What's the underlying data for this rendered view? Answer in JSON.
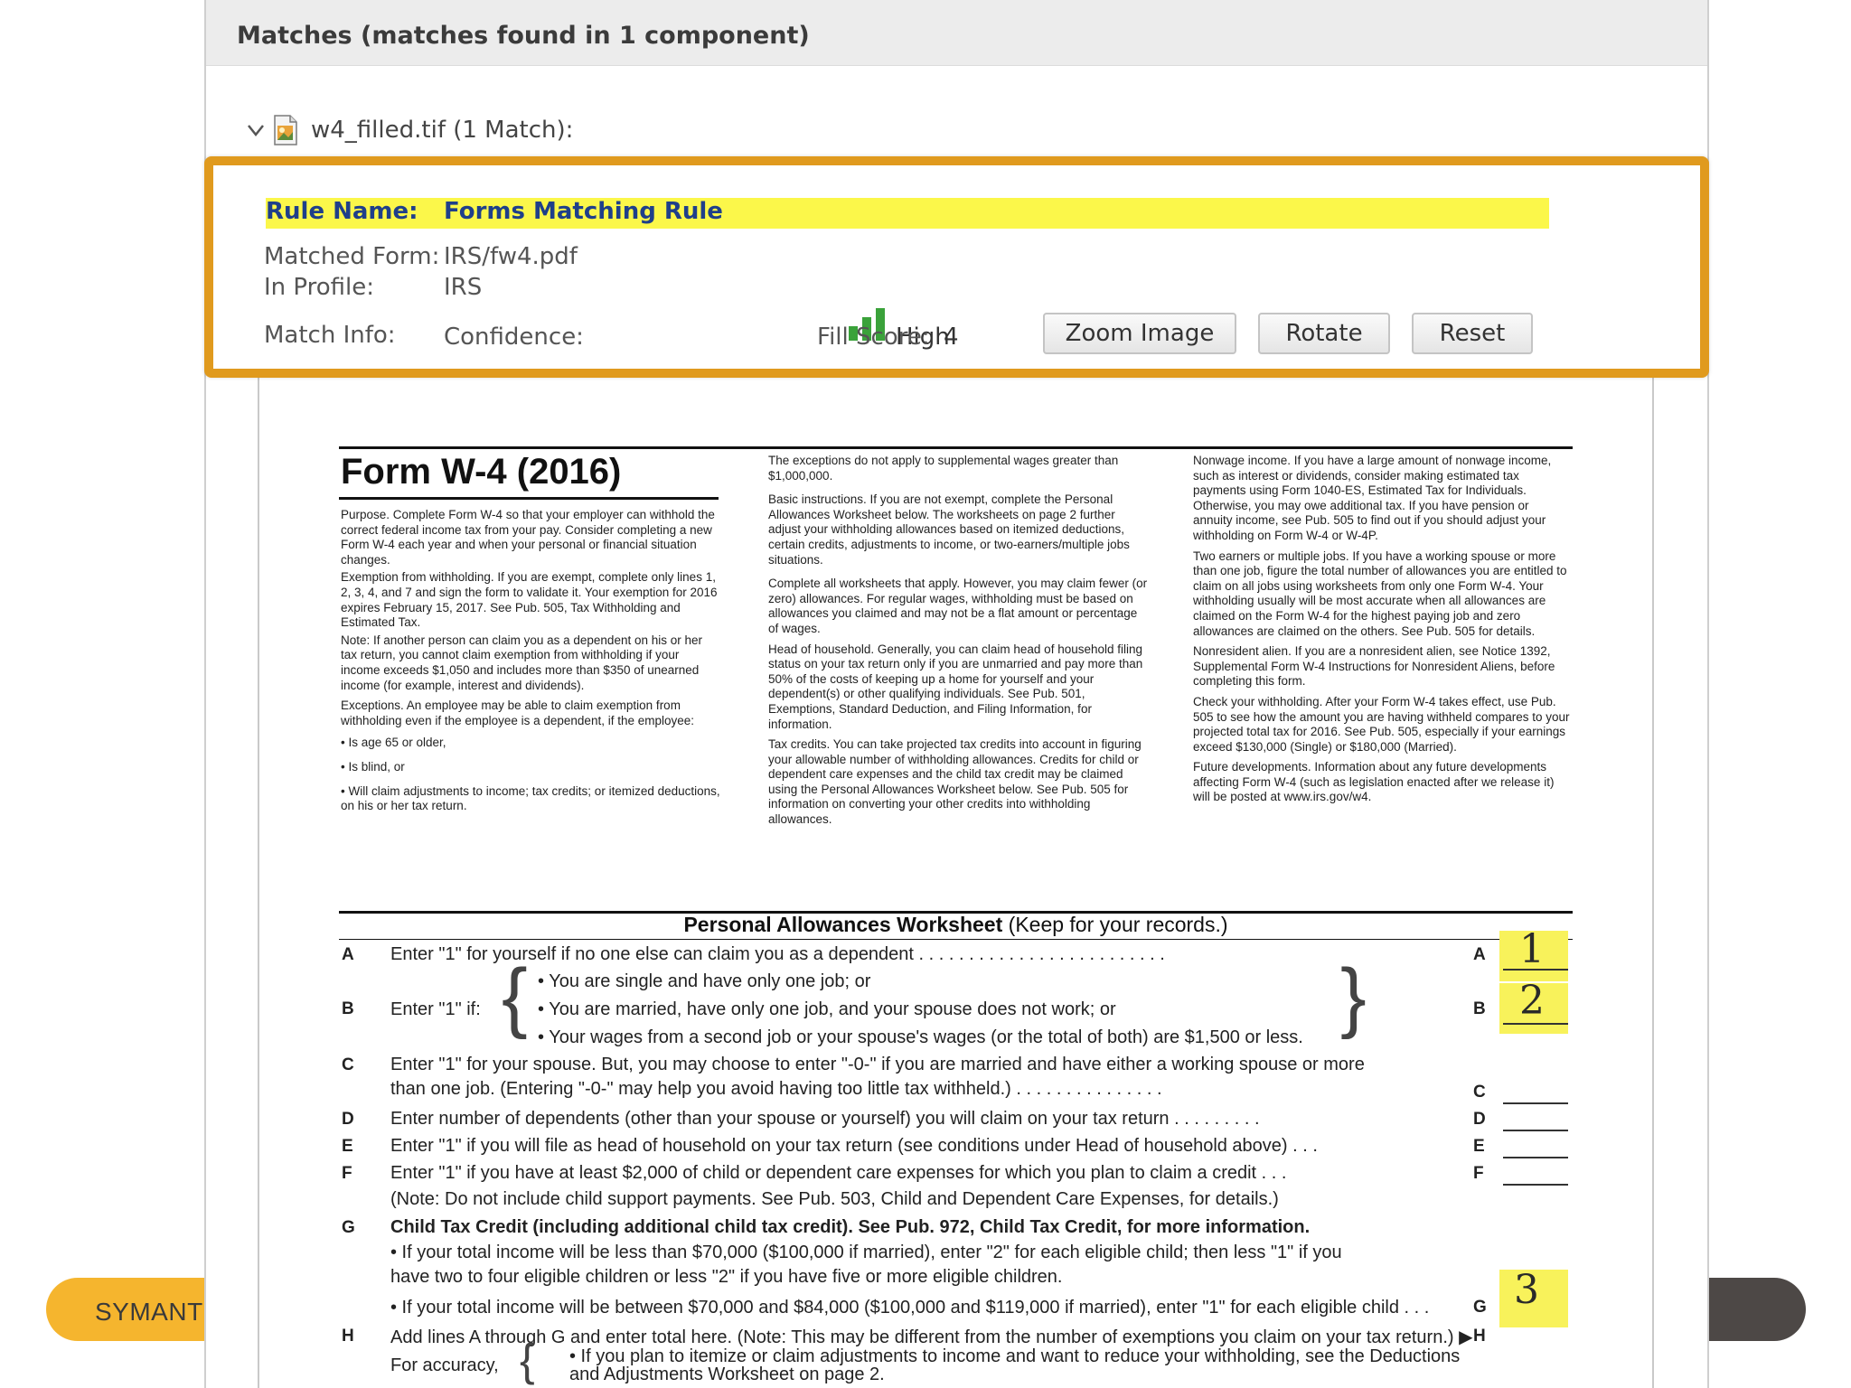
{
  "panel": {
    "title": "Matches (matches found in 1 component)",
    "file_item": "w4_filled.tif  (1 Match):"
  },
  "match": {
    "rule_name_label": "Rule Name:",
    "rule_name_value": "Forms Matching Rule",
    "matched_form_label": "Matched Form:",
    "matched_form_value": "IRS/fw4.pdf",
    "profile_label": "In Profile:",
    "profile_value": "IRS",
    "match_info_label": "Match Info:",
    "confidence_label": "Confidence:",
    "confidence_value": "High",
    "fill_score_label": "Fill Score:",
    "fill_score_value": "4",
    "buttons": {
      "zoom": "Zoom Image",
      "rotate": "Rotate",
      "reset": "Reset"
    }
  },
  "footer": {
    "brand": "SYMANTI"
  },
  "document": {
    "title": "Form W-4 (2016)",
    "col1": {
      "purpose": "Purpose. Complete Form W-4 so that your employer can withhold the correct federal income tax from your pay. Consider completing a new Form W-4 each year and when your personal or financial situation changes.",
      "exemption": "Exemption from withholding. If you are exempt, complete only lines 1, 2, 3, 4, and 7 and sign the form to validate it. Your exemption for 2016 expires February 15, 2017. See Pub. 505, Tax Withholding and Estimated Tax.",
      "note": "Note: If another person can claim you as a dependent on his or her tax return, you cannot claim exemption from withholding if your income exceeds $1,050 and includes more than $350 of unearned income (for example, interest and dividends).",
      "exceptions": "Exceptions. An employee may be able to claim exemption from withholding even if the employee is a dependent, if the employee:",
      "bullet1": "• Is age 65 or older,",
      "bullet2": "• Is blind, or",
      "bullet3": "• Will claim adjustments to income; tax credits; or itemized deductions, on his or her tax return."
    },
    "col2": {
      "p1": "The exceptions do not apply to supplemental wages greater than $1,000,000.",
      "p2": "Basic instructions. If you are not exempt, complete the Personal Allowances Worksheet below. The worksheets on page 2 further adjust your withholding allowances based on itemized deductions, certain credits, adjustments to income, or two-earners/multiple jobs situations.",
      "p3": "Complete all worksheets that apply. However, you may claim fewer (or zero) allowances. For regular wages, withholding must be based on allowances you claimed and may not be a flat amount or percentage of wages.",
      "p4": "Head of household. Generally, you can claim head of household filing status on your tax return only if you are unmarried and pay more than 50% of the costs of keeping up a home for yourself and your dependent(s) or other qualifying individuals. See Pub. 501, Exemptions, Standard Deduction, and Filing Information, for information.",
      "p5": "Tax credits. You can take projected tax credits into account in figuring your allowable number of withholding allowances. Credits for child or dependent care expenses and the child tax credit may be claimed using the Personal Allowances Worksheet below. See Pub. 505 for information on converting your other credits into withholding allowances."
    },
    "col3": {
      "p1": "Nonwage income. If you have a large amount of nonwage income, such as interest or dividends, consider making estimated tax payments using Form 1040-ES, Estimated Tax for Individuals. Otherwise, you may owe additional tax. If you have pension or annuity income, see Pub. 505 to find out if you should adjust your withholding on Form W-4 or W-4P.",
      "p2": "Two earners or multiple jobs. If you have a working spouse or more than one job, figure the total number of allowances you are entitled to claim on all jobs using worksheets from only one Form W-4. Your withholding usually will be most accurate when all allowances are claimed on the Form W-4 for the highest paying job and zero allowances are claimed on the others. See Pub. 505 for details.",
      "p3": "Nonresident alien. If you are a nonresident alien, see Notice 1392, Supplemental Form W-4 Instructions for Nonresident Aliens, before completing this form.",
      "p4": "Check your withholding. After your Form W-4 takes effect, use Pub. 505 to see how the amount you are having withheld compares to your projected total tax for 2016. See Pub. 505, especially if your earnings exceed $130,000 (Single) or $180,000 (Married).",
      "p5": "Future developments. Information about any future developments affecting Form W-4 (such as legislation enacted after we release it) will be posted at www.irs.gov/w4."
    },
    "worksheet": {
      "title": "Personal Allowances Worksheet",
      "title_suffix": "(Keep for your records.)",
      "rows": {
        "A": "Enter \"1\" for yourself if no one else can claim you as a dependent . . . . . . . . . . . . . . . . . . . . . . . . .",
        "B_lead": "Enter \"1\" if:",
        "B1": "• You are single and have only one job; or",
        "B2": "• You are married, have only one job, and your spouse does not work; or",
        "B3": "• Your wages from a second job or your spouse's wages (or the total of both) are $1,500 or less.",
        "C1": "Enter \"1\" for your spouse. But, you may choose to enter \"-0-\" if you are married and have either a working spouse or more",
        "C2": "than one job. (Entering \"-0-\" may help you avoid having too little tax withheld.) . . . . . . . . . . . . . . .",
        "D": "Enter number of dependents (other than your spouse or yourself) you will claim on your tax return . . . . . . . . .",
        "E": "Enter \"1\" if you will file as head of household on your tax return (see conditions under Head of household above) . . .",
        "F1": "Enter \"1\" if you have at least $2,000 of child or dependent care expenses for which you plan to claim a credit . . .",
        "F2": "(Note: Do not include child support payments. See Pub. 503, Child and Dependent Care Expenses, for details.)",
        "G1": "Child Tax Credit (including additional child tax credit). See Pub. 972, Child Tax Credit, for more information.",
        "G2": "• If your total income will be less than $70,000 ($100,000 if married), enter \"2\" for each eligible child; then less \"1\" if you",
        "G3": "have two to four eligible children or less \"2\" if you have five or more eligible children.",
        "G4": "• If your total income will be between $70,000 and $84,000 ($100,000 and $119,000 if married), enter \"1\" for each eligible child . . .",
        "H": "Add lines A through G and enter total here. (Note: This may be different from the number of exemptions you claim on your tax return.) ▶",
        "I_lead": "For accuracy,",
        "I1": "• If you plan to itemize or claim adjustments to income and want to reduce your withholding, see the Deductions",
        "I2": "and Adjustments Worksheet on page 2."
      },
      "letters": [
        "A",
        "B",
        "C",
        "D",
        "E",
        "F",
        "G",
        "H"
      ],
      "answers": {
        "A": "1",
        "B": "2",
        "G": "3"
      }
    }
  }
}
